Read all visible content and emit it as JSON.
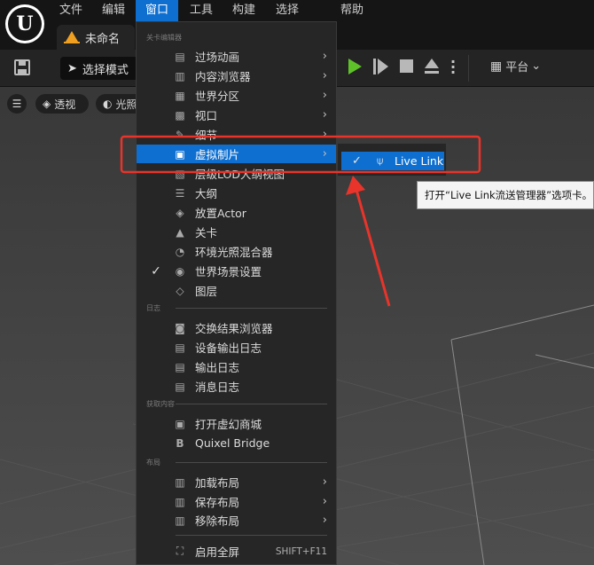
{
  "menubar": {
    "logo_letter": "U",
    "items": [
      {
        "label": "文件"
      },
      {
        "label": "编辑"
      },
      {
        "label": "窗口"
      },
      {
        "label": "工具"
      },
      {
        "label": "构建"
      },
      {
        "label": "选择"
      },
      {
        "label": "帮助"
      }
    ]
  },
  "document_tab": {
    "label": "未命名"
  },
  "toolbar": {
    "mode_label": "选择模式",
    "platform_label": "平台",
    "platform_chevron": "⌄"
  },
  "viewport": {
    "perspective_label": "透视",
    "lit_label": "光照"
  },
  "window_menu": {
    "sections": {
      "level_editor": "关卡编辑器",
      "log": "日志",
      "get_content": "获取内容",
      "layout": "布局"
    },
    "level_editor_items": [
      {
        "label": "过场动画",
        "icon": "clapper-icon",
        "glyph": "▤",
        "submenu": true
      },
      {
        "label": "内容浏览器",
        "icon": "content-browser-icon",
        "glyph": "▥",
        "submenu": true
      },
      {
        "label": "世界分区",
        "icon": "world-partition-icon",
        "glyph": "▦",
        "submenu": true
      },
      {
        "label": "视口",
        "icon": "viewport-icon",
        "glyph": "▩",
        "submenu": true
      },
      {
        "label": "细节",
        "icon": "pencil-icon",
        "glyph": "✎",
        "submenu": true
      },
      {
        "label": "虚拟制片",
        "icon": "virtual-production-icon",
        "glyph": "▣",
        "submenu": true,
        "highlighted": true
      },
      {
        "label": "层级LOD大纲视图",
        "icon": "hlod-icon",
        "glyph": "▧",
        "submenu": false
      },
      {
        "label": "大纲",
        "icon": "outliner-icon",
        "glyph": "☰",
        "submenu": false
      },
      {
        "label": "放置Actor",
        "icon": "place-actor-icon",
        "glyph": "◈",
        "submenu": false
      },
      {
        "label": "关卡",
        "icon": "levels-icon",
        "glyph": "▲",
        "submenu": false
      },
      {
        "label": "环境光照混合器",
        "icon": "env-light-icon",
        "glyph": "◔",
        "submenu": false
      },
      {
        "label": "世界场景设置",
        "icon": "world-settings-icon",
        "glyph": "◉",
        "submenu": false,
        "checked": true
      },
      {
        "label": "图层",
        "icon": "layers-icon",
        "glyph": "◇",
        "submenu": false
      }
    ],
    "log_items": [
      {
        "label": "交换结果浏览器",
        "icon": "interchange-icon",
        "glyph": "◙"
      },
      {
        "label": "设备输出日志",
        "icon": "device-log-icon",
        "glyph": "▤"
      },
      {
        "label": "输出日志",
        "icon": "output-log-icon",
        "glyph": "▤"
      },
      {
        "label": "消息日志",
        "icon": "message-log-icon",
        "glyph": "▤"
      }
    ],
    "content_items": [
      {
        "label": "打开虚幻商城",
        "icon": "marketplace-icon",
        "glyph": "▣"
      },
      {
        "label": "Quixel Bridge",
        "icon": "quixel-bridge-icon",
        "glyph": "B"
      }
    ],
    "layout_items": [
      {
        "label": "加载布局",
        "icon": "load-layout-icon",
        "glyph": "▥",
        "submenu": true
      },
      {
        "label": "保存布局",
        "icon": "save-layout-icon",
        "glyph": "▥",
        "submenu": true
      },
      {
        "label": "移除布局",
        "icon": "remove-layout-icon",
        "glyph": "▥",
        "submenu": true
      }
    ],
    "fullscreen": {
      "label": "启用全屏",
      "shortcut": "SHIFT+F11",
      "icon": "fullscreen-icon",
      "glyph": "⛶"
    },
    "check_glyph": "✓",
    "arrow_glyph": "›"
  },
  "submenu": {
    "item_label": "Live Link",
    "check_glyph": "✓",
    "icon_glyph": "⍦"
  },
  "tooltip": {
    "text": "打开“Live Link流送管理器”选项卡。"
  },
  "colors": {
    "accent": "#0e6fd0",
    "annotation_red": "#e8342a",
    "play_green": "#5fc12a"
  }
}
